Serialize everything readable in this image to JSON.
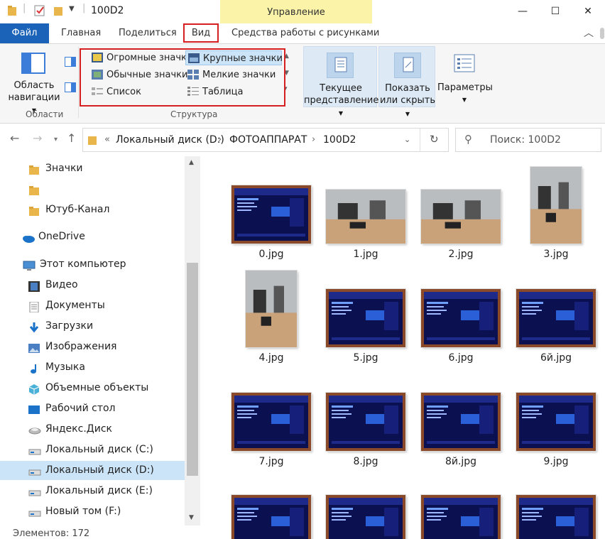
{
  "window": {
    "title": "100D2",
    "contextual_tab_group": "Управление",
    "controls": {
      "minimize": "—",
      "maximize": "☐",
      "close": "✕"
    }
  },
  "tabs": {
    "file": "Файл",
    "home": "Главная",
    "share": "Поделиться",
    "view": "Вид",
    "picture_tools": "Средства работы с рисунками"
  },
  "ribbon": {
    "nav_pane_line1": "Область",
    "nav_pane_line2": "навигации",
    "group_areas": "Области",
    "layout": {
      "huge_icons": "Огромные значки",
      "large_icons": "Крупные значки",
      "medium_icons": "Обычные значки",
      "small_icons": "Мелкие значки",
      "list": "Список",
      "table": "Таблица"
    },
    "group_structure": "Структура",
    "current_view_line1": "Текущее",
    "current_view_line2": "представление",
    "show_hide_line1": "Показать",
    "show_hide_line2": "или скрыть",
    "options": "Параметры"
  },
  "address": {
    "prefix": "«",
    "parts": [
      "Локальный диск (D:)",
      "ФОТОАППАРАТ",
      "100D2"
    ],
    "search_placeholder": "Поиск: 100D2"
  },
  "sidebar": [
    {
      "label": "Значки",
      "icon": "folder-icon"
    },
    {
      "label": "",
      "icon": "folder-icon"
    },
    {
      "label": "Ютуб-Канал",
      "icon": "folder-icon"
    },
    {
      "label": "OneDrive",
      "icon": "cloud-icon"
    },
    {
      "label": "Этот компьютер",
      "icon": "computer-icon"
    },
    {
      "label": "Видео",
      "icon": "video-icon"
    },
    {
      "label": "Документы",
      "icon": "documents-icon"
    },
    {
      "label": "Загрузки",
      "icon": "download-icon"
    },
    {
      "label": "Изображения",
      "icon": "pictures-icon"
    },
    {
      "label": "Музыка",
      "icon": "music-icon"
    },
    {
      "label": "Объемные объекты",
      "icon": "3d-objects-icon"
    },
    {
      "label": "Рабочий стол",
      "icon": "desktop-icon"
    },
    {
      "label": "Яндекс.Диск",
      "icon": "yandex-disk-icon"
    },
    {
      "label": "Локальный диск (C:)",
      "icon": "drive-icon"
    },
    {
      "label": "Локальный диск (D:)",
      "icon": "drive-icon",
      "selected": true
    },
    {
      "label": "Локальный диск (E:)",
      "icon": "drive-icon"
    },
    {
      "label": "Новый том (F:)",
      "icon": "drive-icon"
    }
  ],
  "files": [
    {
      "name": "0.jpg",
      "kind": "bios"
    },
    {
      "name": "1.jpg",
      "kind": "photo"
    },
    {
      "name": "2.jpg",
      "kind": "photo"
    },
    {
      "name": "3.jpg",
      "kind": "photo-portrait"
    },
    {
      "name": "4.jpg",
      "kind": "photo-portrait"
    },
    {
      "name": "5.jpg",
      "kind": "bios"
    },
    {
      "name": "6.jpg",
      "kind": "bios"
    },
    {
      "name": "6й.jpg",
      "kind": "bios"
    },
    {
      "name": "7.jpg",
      "kind": "bios"
    },
    {
      "name": "8.jpg",
      "kind": "bios"
    },
    {
      "name": "8й.jpg",
      "kind": "bios"
    },
    {
      "name": "9.jpg",
      "kind": "bios"
    },
    {
      "name": "",
      "kind": "bios"
    },
    {
      "name": "",
      "kind": "bios"
    },
    {
      "name": "",
      "kind": "bios"
    },
    {
      "name": "",
      "kind": "bios"
    }
  ],
  "status": "Элементов: 172",
  "colors": {
    "accent": "#1a63b8",
    "highlight_box": "#d62020",
    "contextual": "#faf3a8",
    "selected": "#cce4f7"
  }
}
